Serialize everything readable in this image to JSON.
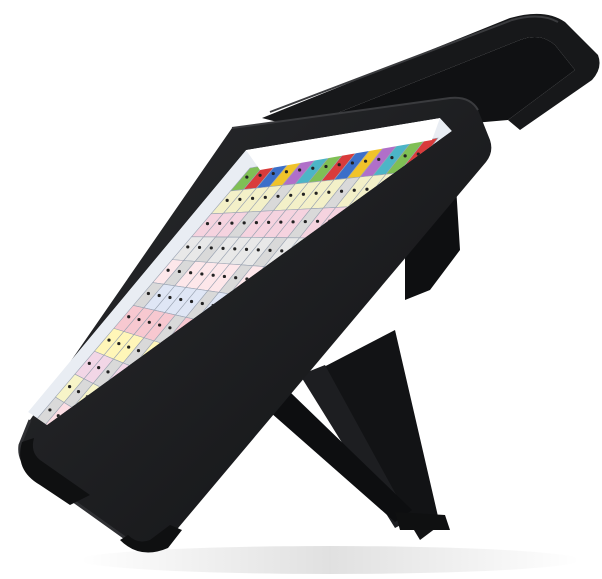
{
  "device": {
    "body_color": "#1b1c1e",
    "edge_highlight": "#3a3b3e",
    "bumper_color": "#0f1011"
  },
  "screen": {
    "background": "#e9edf3",
    "text_bar_color": "#ffffff",
    "grid_rows": 11,
    "grid_cols": 14,
    "row_colors": [
      "#f7c8d0",
      "#f3f0c8",
      "#f5d3df",
      "#e8e8e8",
      "#fde7ea",
      "#dfe6f5",
      "#f7c8d0",
      "#fff6b8",
      "#f2d6e6",
      "#f7f4c8",
      "#fbdde3"
    ],
    "accent_colors": [
      "#7fbf55",
      "#d93b3b",
      "#3c6fc9",
      "#f0c32a",
      "#b06fc9",
      "#4cb5c7"
    ]
  }
}
